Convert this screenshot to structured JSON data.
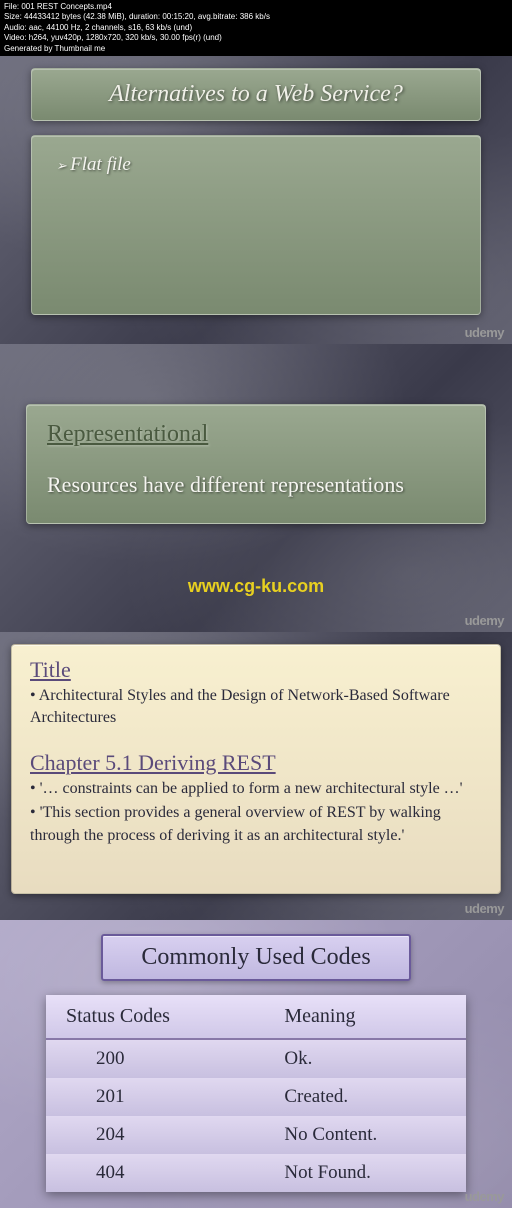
{
  "meta": {
    "line1": "File: 001 REST Concepts.mp4",
    "line2": "Size: 44433412 bytes (42.38 MiB), duration: 00:15:20, avg.bitrate: 386 kb/s",
    "line3": "Audio: aac, 44100 Hz, 2 channels, s16, 63 kb/s (und)",
    "line4": "Video: h264, yuv420p, 1280x720, 320 kb/s, 30.00 fps(r) (und)",
    "line5": "Generated by Thumbnail me"
  },
  "brand": "udemy",
  "slide1": {
    "title": "Alternatives to a Web Service?",
    "bullet": "Flat file"
  },
  "slide2": {
    "heading": "Representational",
    "text": "Resources have different representations",
    "watermark": "www.cg-ku.com"
  },
  "slide3": {
    "title_heading": "Title",
    "title_text": "• Architectural Styles and the Design of Network-Based Software Architectures",
    "chapter_heading": "Chapter 5.1 Deriving REST",
    "chapter_text1": "• '… constraints can be applied to form a new architectural style …'",
    "chapter_text2": "• 'This section provides a general overview of REST by walking through the process of deriving it as an architectural style.'"
  },
  "slide4": {
    "title": "Commonly Used Codes",
    "headers": {
      "col1": "Status Codes",
      "col2": "Meaning"
    },
    "rows": [
      {
        "code": "200",
        "meaning": "Ok."
      },
      {
        "code": "201",
        "meaning": "Created."
      },
      {
        "code": "204",
        "meaning": "No Content."
      },
      {
        "code": "404",
        "meaning": "Not Found."
      }
    ]
  }
}
